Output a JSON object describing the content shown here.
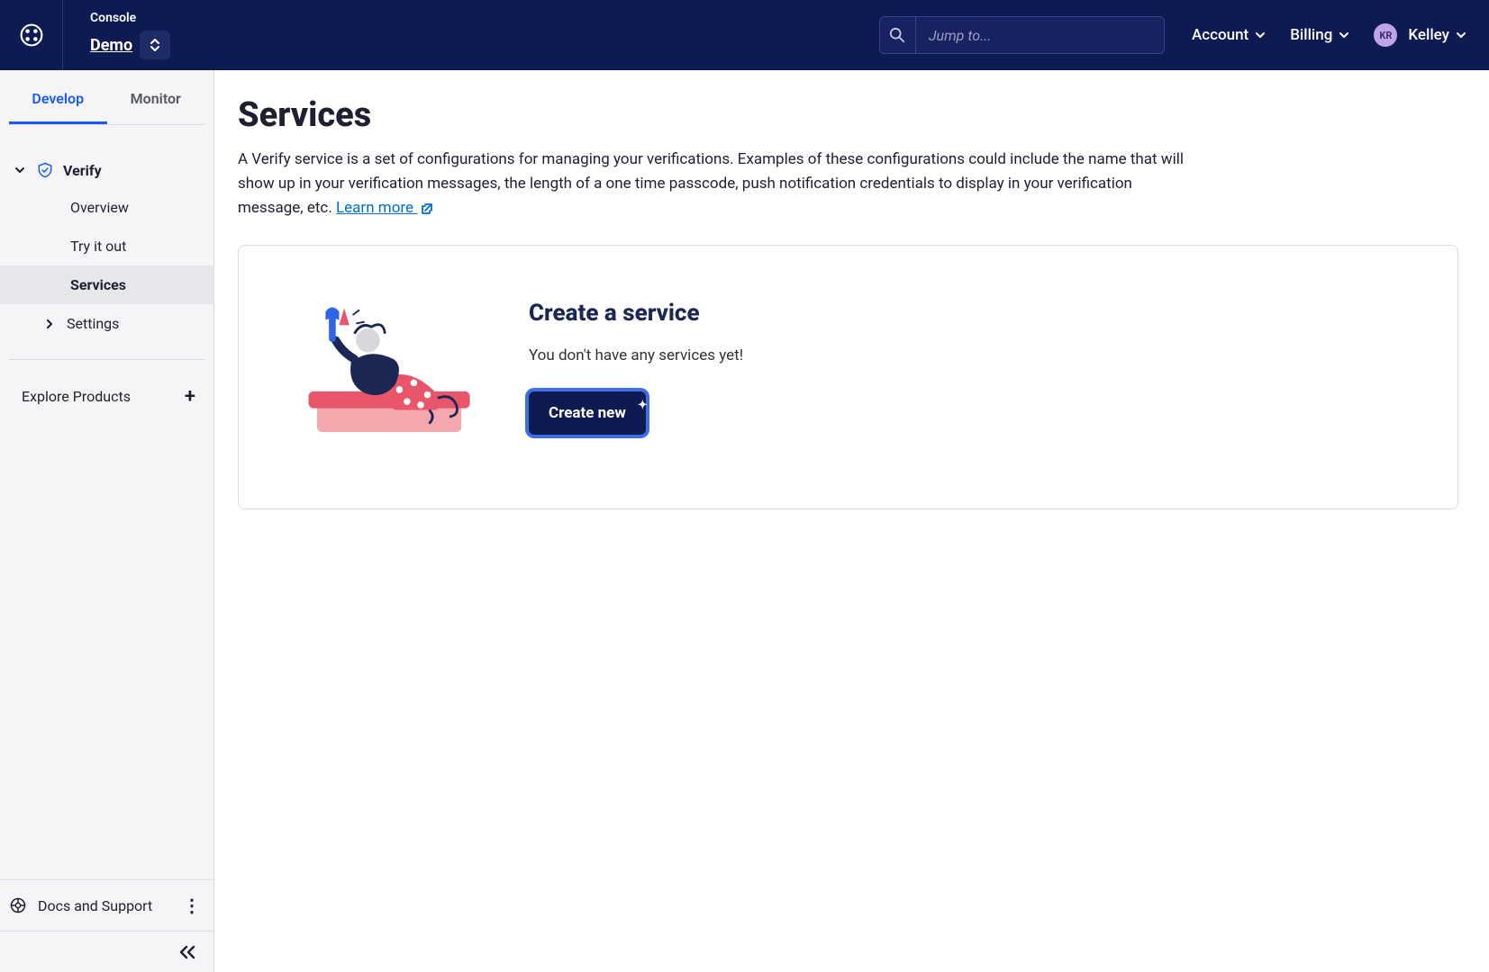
{
  "header": {
    "console_label": "Console",
    "project_name": "Demo",
    "search_placeholder": "Jump to...",
    "account_label": "Account",
    "billing_label": "Billing",
    "user_initials": "KR",
    "user_name": "Kelley"
  },
  "sidebar": {
    "tabs": [
      "Develop",
      "Monitor"
    ],
    "product": "Verify",
    "items": [
      {
        "label": "Overview"
      },
      {
        "label": "Try it out"
      },
      {
        "label": "Services"
      },
      {
        "label": "Settings"
      }
    ],
    "explore_label": "Explore Products",
    "docs_label": "Docs and Support"
  },
  "main": {
    "title": "Services",
    "description": "A Verify service is a set of configurations for managing your verifications. Examples of these configurations could include the name that will show up in your verification messages, the length of a one time passcode, push notification credentials to display in your verification message, etc. ",
    "learn_more": "Learn more",
    "card_title": "Create a service",
    "card_subtitle": "You don't have any services yet!",
    "create_button": "Create new"
  }
}
